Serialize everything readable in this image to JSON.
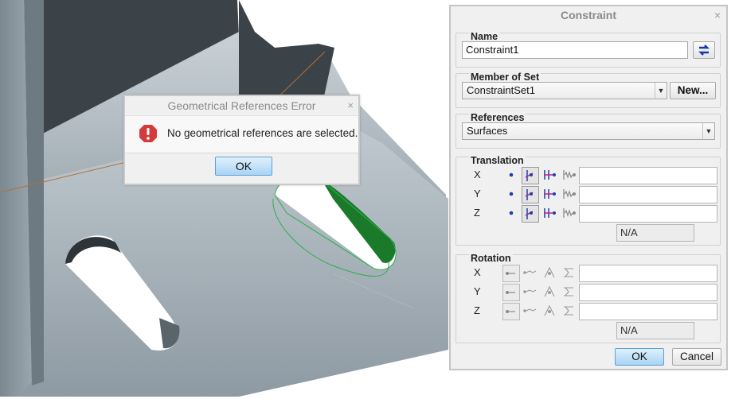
{
  "error_dialog": {
    "title": "Geometrical References Error",
    "close": "×",
    "message": "No geometrical references are selected.",
    "ok_label": "OK"
  },
  "constraint_dialog": {
    "title": "Constraint",
    "close": "×",
    "name_group": {
      "label": "Name",
      "value": "Constraint1"
    },
    "member_group": {
      "label": "Member of Set",
      "value": "ConstraintSet1",
      "new_label": "New..."
    },
    "references_group": {
      "label": "References",
      "value": "Surfaces"
    },
    "translation": {
      "label": "Translation",
      "axes": [
        "X",
        "Y",
        "Z"
      ],
      "na": "N/A"
    },
    "rotation": {
      "label": "Rotation",
      "axes": [
        "X",
        "Y",
        "Z"
      ],
      "na": "N/A"
    },
    "ok_label": "OK",
    "cancel_label": "Cancel"
  },
  "colors": {
    "accent": "#1a7a2a",
    "part": "#a8b4bc",
    "ok_button": "#a9d4f5"
  }
}
